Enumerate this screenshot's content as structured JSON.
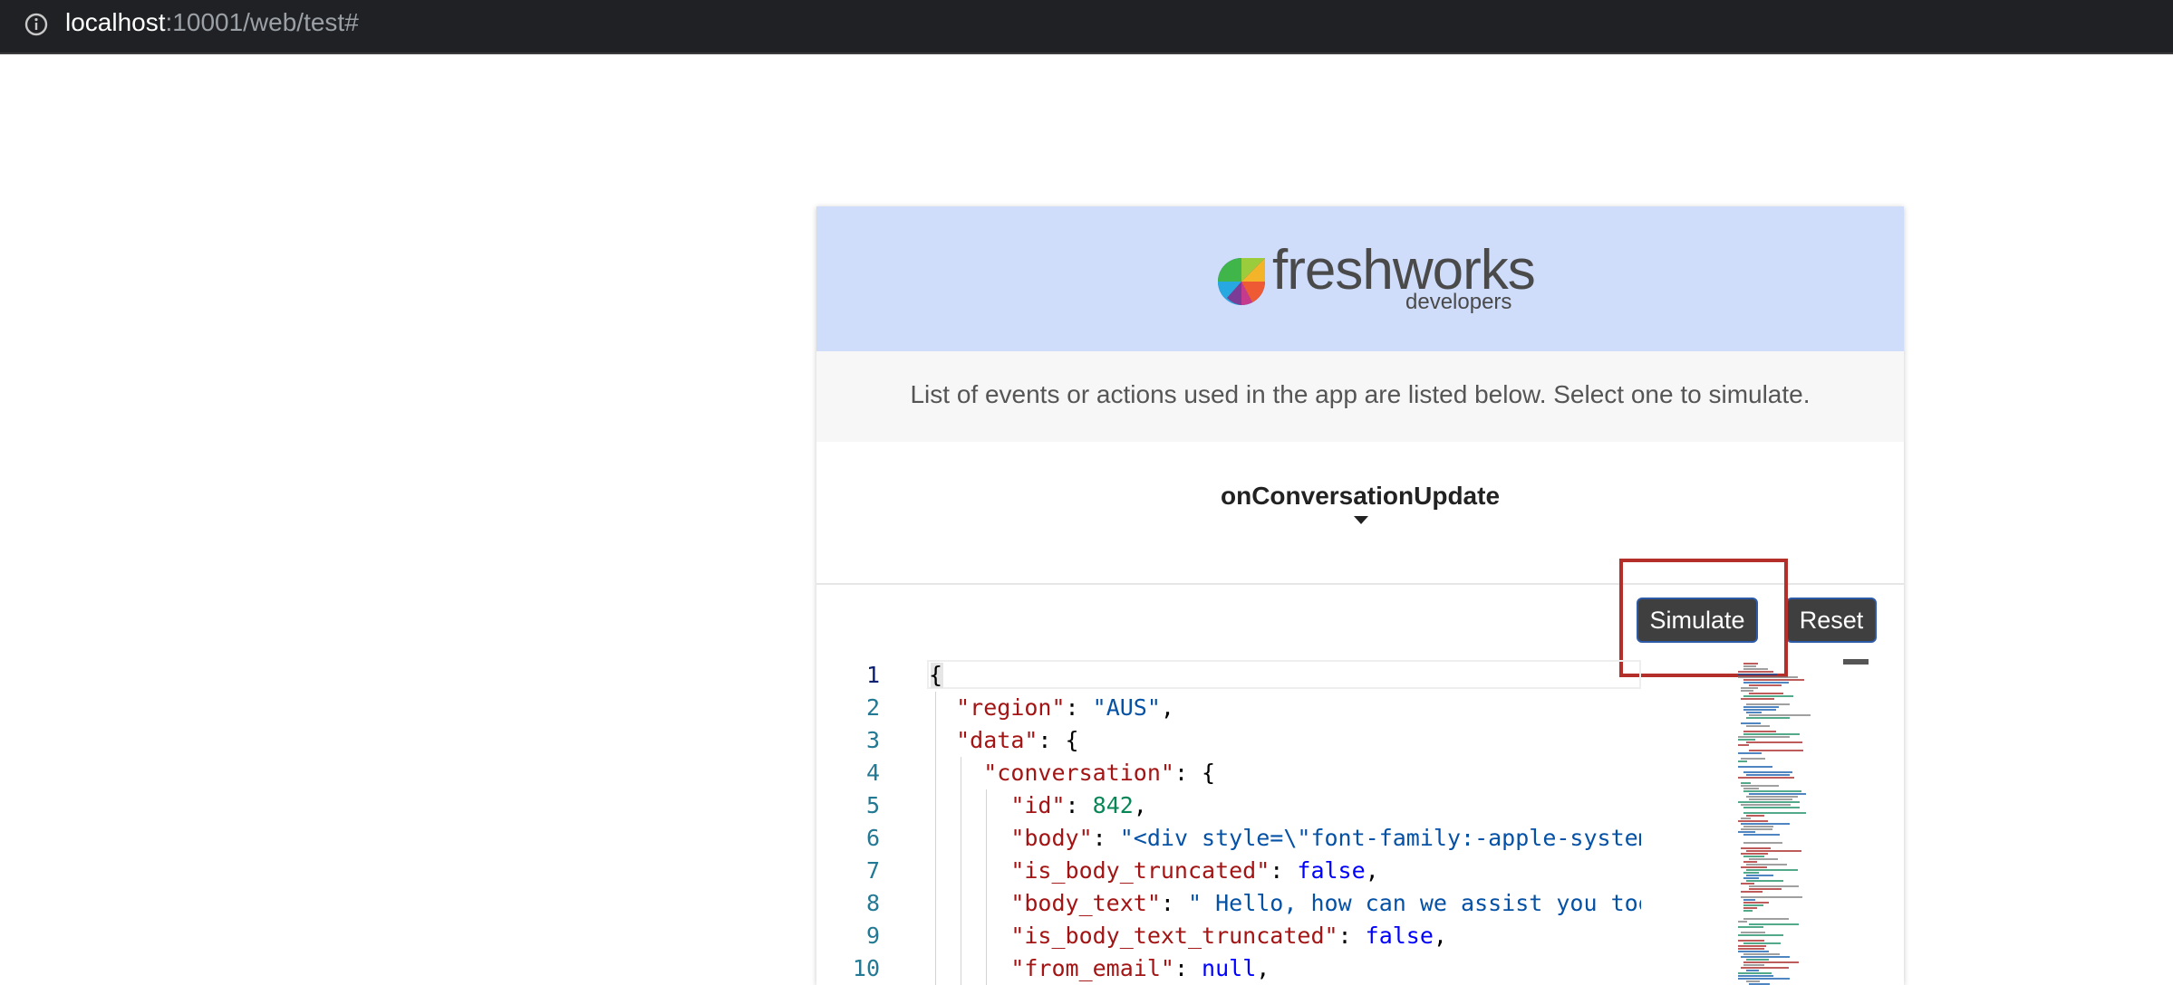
{
  "browser": {
    "url_host": "localhost",
    "url_rest": ":10001/web/test#",
    "info_icon": "info-icon"
  },
  "brand": {
    "name": "freshworks",
    "sub": "developers",
    "logo_icon": "freshworks-logo-icon"
  },
  "intro": {
    "text": "List of events or actions used in the app are listed below. Select one to simulate."
  },
  "event_select": {
    "selected": "onConversationUpdate",
    "icon": "caret-down-icon"
  },
  "actions": {
    "simulate_label": "Simulate",
    "reset_label": "Reset"
  },
  "editor": {
    "line_numbers": [
      "1",
      "2",
      "3",
      "4",
      "5",
      "6",
      "7",
      "8",
      "9",
      "10"
    ],
    "lines": [
      [
        {
          "t": "p",
          "v": "{"
        }
      ],
      [
        {
          "t": "p",
          "v": "  "
        },
        {
          "t": "k",
          "v": "\"region\""
        },
        {
          "t": "p",
          "v": ": "
        },
        {
          "t": "s",
          "v": "\"AUS\""
        },
        {
          "t": "p",
          "v": ","
        }
      ],
      [
        {
          "t": "p",
          "v": "  "
        },
        {
          "t": "k",
          "v": "\"data\""
        },
        {
          "t": "p",
          "v": ": {"
        }
      ],
      [
        {
          "t": "p",
          "v": "    "
        },
        {
          "t": "k",
          "v": "\"conversation\""
        },
        {
          "t": "p",
          "v": ": {"
        }
      ],
      [
        {
          "t": "p",
          "v": "      "
        },
        {
          "t": "k",
          "v": "\"id\""
        },
        {
          "t": "p",
          "v": ": "
        },
        {
          "t": "n",
          "v": "842"
        },
        {
          "t": "p",
          "v": ","
        }
      ],
      [
        {
          "t": "p",
          "v": "      "
        },
        {
          "t": "k",
          "v": "\"body\""
        },
        {
          "t": "p",
          "v": ": "
        },
        {
          "t": "s",
          "v": "\"<div style=\\\"font-family:-apple-system, BlinkMa"
        }
      ],
      [
        {
          "t": "p",
          "v": "      "
        },
        {
          "t": "k",
          "v": "\"is_body_truncated\""
        },
        {
          "t": "p",
          "v": ": "
        },
        {
          "t": "b",
          "v": "false"
        },
        {
          "t": "p",
          "v": ","
        }
      ],
      [
        {
          "t": "p",
          "v": "      "
        },
        {
          "t": "k",
          "v": "\"body_text\""
        },
        {
          "t": "p",
          "v": ": "
        },
        {
          "t": "s",
          "v": "\" Hello, how can we assist you today?\""
        },
        {
          "t": "p",
          "v": ","
        }
      ],
      [
        {
          "t": "p",
          "v": "      "
        },
        {
          "t": "k",
          "v": "\"is_body_text_truncated\""
        },
        {
          "t": "p",
          "v": ": "
        },
        {
          "t": "b",
          "v": "false"
        },
        {
          "t": "p",
          "v": ","
        }
      ],
      [
        {
          "t": "p",
          "v": "      "
        },
        {
          "t": "k",
          "v": "\"from_email\""
        },
        {
          "t": "p",
          "v": ": "
        },
        {
          "t": "b",
          "v": "null"
        },
        {
          "t": "p",
          "v": ","
        }
      ]
    ]
  }
}
